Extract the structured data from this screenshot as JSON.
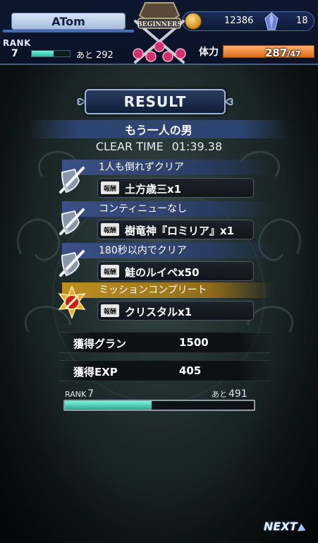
{
  "header": {
    "player_name": "ATom",
    "rank_label": "RANK",
    "rank": "7",
    "exp_rest_label": "あと",
    "exp_rest": "292",
    "exp_progress": 0.58,
    "emblem_text": "BEGINNERS",
    "gil": "12386",
    "crystals": "18",
    "stamina_label": "体力",
    "stamina_current": "287",
    "stamina_max": "/47",
    "stamina_progress": 1.0
  },
  "result": {
    "title": "RESULT",
    "quest_name": "もう一人の男",
    "clear_time_label": "CLEAR TIME",
    "clear_time": "01:39.38"
  },
  "missions": [
    {
      "condition": "1人も倒れずクリア",
      "reward_tag": "報酬",
      "reward": "土方歳三x1",
      "icon": "sword-shield-icon"
    },
    {
      "condition": "コンティニューなし",
      "reward_tag": "報酬",
      "reward": "樹竜神『ロミリア』x1",
      "icon": "sword-shield-icon"
    },
    {
      "condition": "180秒以内でクリア",
      "reward_tag": "報酬",
      "reward": "鮭のルイペx50",
      "icon": "sword-shield-icon"
    },
    {
      "condition": "ミッションコンプリート",
      "reward_tag": "報酬",
      "reward": "クリスタルx1",
      "icon": "gold-medal-icon"
    }
  ],
  "totals": {
    "gil_label": "獲得グラン",
    "gil_value": "1500",
    "exp_label": "獲得EXP",
    "exp_value": "405"
  },
  "rank_progress": {
    "label": "RANK",
    "rank": "7",
    "rest_label": "あと",
    "rest": "491",
    "progress": 0.46
  },
  "next_button": {
    "label": "NEXT"
  },
  "colors": {
    "exp_bar": "#2cbca4",
    "stamina_bar": "#e06a18",
    "mission_band": "#3c528c",
    "mission_complete_band": "#c8961e"
  }
}
